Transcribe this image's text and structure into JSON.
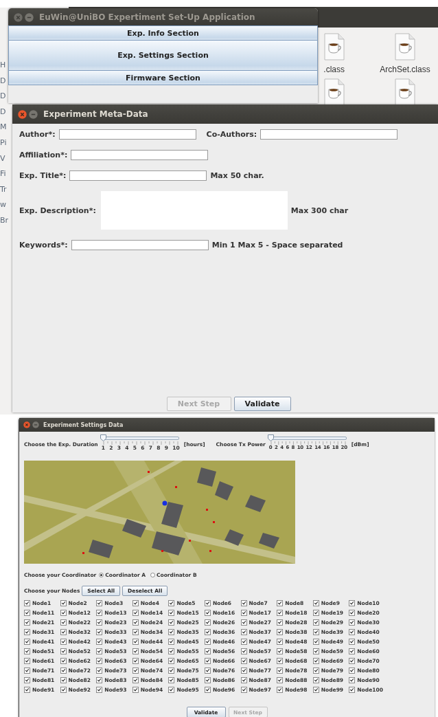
{
  "desktop": {
    "side_fragments": [
      "H",
      "D",
      "D",
      "D",
      "M",
      "Pi",
      "V",
      "Fi",
      "Tr",
      "w",
      "Br"
    ],
    "files": [
      {
        "name": ".class"
      },
      {
        "name": "ArchSet.class"
      }
    ]
  },
  "main_window": {
    "title": "EuWin@UniBO Expertiment Set-Up Application",
    "sections": [
      {
        "label": "Exp. Info Section",
        "kind": "short"
      },
      {
        "label": "Exp. Settings Section",
        "kind": "tall"
      },
      {
        "label": "Firmware Section",
        "kind": "short"
      }
    ]
  },
  "meta_window": {
    "title": "Experiment Meta-Data",
    "rows": [
      {
        "fields": [
          {
            "label": "Author*:",
            "kind": "line"
          },
          {
            "label": "Co-Authors:",
            "kind": "line"
          }
        ]
      },
      {
        "fields": [
          {
            "label": "Affiliation*:",
            "kind": "line"
          }
        ]
      },
      {
        "fields": [
          {
            "label": "Exp. Title*:",
            "kind": "line",
            "note": "Max 50 char."
          }
        ]
      },
      {
        "fields": [
          {
            "label": "Exp. Description*:",
            "kind": "area",
            "note": "Max 300 char"
          }
        ]
      },
      {
        "fields": [
          {
            "label": "Keywords*:",
            "kind": "line",
            "note": "Min 1 Max 5 - Space separated"
          }
        ]
      }
    ],
    "buttons": [
      {
        "label": "Next Step",
        "disabled": true
      },
      {
        "label": "Validate",
        "disabled": false
      }
    ]
  },
  "settings_window": {
    "title": "Experiment Settings Data",
    "sliders": [
      {
        "label": "Choose the Exp. Duration",
        "ticks": [
          "1",
          "2",
          "3",
          "4",
          "5",
          "6",
          "7",
          "8",
          "9",
          "10"
        ],
        "unit": "[hours]",
        "level": 0
      },
      {
        "label": "Choose Tx Power",
        "ticks": [
          "0",
          "2",
          "4",
          "6",
          "8",
          "10",
          "12",
          "14",
          "16",
          "18",
          "20"
        ],
        "unit": "[dBm]",
        "level": 0
      }
    ],
    "coordinator": {
      "label": "Choose your Coordinator",
      "options": [
        {
          "label": "Coordinator A",
          "selected": true
        },
        {
          "label": "Coordinator B",
          "selected": false
        }
      ]
    },
    "nodes": {
      "label": "Choose your Nodes",
      "buttons": [
        "Select All",
        "Deselect All"
      ],
      "items": [
        {
          "label": "Node1",
          "checked": true
        },
        {
          "label": "Node2",
          "checked": true
        },
        {
          "label": "Node3",
          "checked": true
        },
        {
          "label": "Node4",
          "checked": true
        },
        {
          "label": "Node5",
          "checked": true
        },
        {
          "label": "Node6",
          "checked": true
        },
        {
          "label": "Node7",
          "checked": true
        },
        {
          "label": "Node8",
          "checked": true
        },
        {
          "label": "Node9",
          "checked": true
        },
        {
          "label": "Node10",
          "checked": true
        },
        {
          "label": "Node11",
          "checked": true
        },
        {
          "label": "Node12",
          "checked": true
        },
        {
          "label": "Node13",
          "checked": true
        },
        {
          "label": "Node14",
          "checked": true
        },
        {
          "label": "Node15",
          "checked": true
        },
        {
          "label": "Node16",
          "checked": true
        },
        {
          "label": "Node17",
          "checked": true
        },
        {
          "label": "Node18",
          "checked": true
        },
        {
          "label": "Node19",
          "checked": true
        },
        {
          "label": "Node20",
          "checked": true
        },
        {
          "label": "Node21",
          "checked": true
        },
        {
          "label": "Node22",
          "checked": true
        },
        {
          "label": "Node23",
          "checked": true
        },
        {
          "label": "Node24",
          "checked": true
        },
        {
          "label": "Node25",
          "checked": true
        },
        {
          "label": "Node26",
          "checked": true
        },
        {
          "label": "Node27",
          "checked": true
        },
        {
          "label": "Node28",
          "checked": true
        },
        {
          "label": "Node29",
          "checked": true
        },
        {
          "label": "Node30",
          "checked": true
        },
        {
          "label": "Node31",
          "checked": true
        },
        {
          "label": "Node32",
          "checked": true
        },
        {
          "label": "Node33",
          "checked": true
        },
        {
          "label": "Node34",
          "checked": true
        },
        {
          "label": "Node35",
          "checked": true
        },
        {
          "label": "Node36",
          "checked": true
        },
        {
          "label": "Node37",
          "checked": true
        },
        {
          "label": "Node38",
          "checked": true
        },
        {
          "label": "Node39",
          "checked": true
        },
        {
          "label": "Node40",
          "checked": true
        },
        {
          "label": "Node41",
          "checked": true
        },
        {
          "label": "Node42",
          "checked": true
        },
        {
          "label": "Node43",
          "checked": true
        },
        {
          "label": "Node44",
          "checked": true
        },
        {
          "label": "Node45",
          "checked": true
        },
        {
          "label": "Node46",
          "checked": true
        },
        {
          "label": "Node47",
          "checked": true
        },
        {
          "label": "Node48",
          "checked": true
        },
        {
          "label": "Node49",
          "checked": true
        },
        {
          "label": "Node50",
          "checked": true
        },
        {
          "label": "Node51",
          "checked": true
        },
        {
          "label": "Node52",
          "checked": true
        },
        {
          "label": "Node53",
          "checked": true
        },
        {
          "label": "Node54",
          "checked": true
        },
        {
          "label": "Node55",
          "checked": true
        },
        {
          "label": "Node56",
          "checked": true
        },
        {
          "label": "Node57",
          "checked": true
        },
        {
          "label": "Node58",
          "checked": true
        },
        {
          "label": "Node59",
          "checked": true
        },
        {
          "label": "Node60",
          "checked": true
        },
        {
          "label": "Node61",
          "checked": true
        },
        {
          "label": "Node62",
          "checked": true
        },
        {
          "label": "Node63",
          "checked": true
        },
        {
          "label": "Node64",
          "checked": true
        },
        {
          "label": "Node65",
          "checked": true
        },
        {
          "label": "Node66",
          "checked": true
        },
        {
          "label": "Node67",
          "checked": true
        },
        {
          "label": "Node68",
          "checked": true
        },
        {
          "label": "Node69",
          "checked": true
        },
        {
          "label": "Node70",
          "checked": true
        },
        {
          "label": "Node71",
          "checked": true
        },
        {
          "label": "Node72",
          "checked": true
        },
        {
          "label": "Node73",
          "checked": true
        },
        {
          "label": "Node74",
          "checked": true
        },
        {
          "label": "Node75",
          "checked": true
        },
        {
          "label": "Node76",
          "checked": true
        },
        {
          "label": "Node77",
          "checked": true
        },
        {
          "label": "Node78",
          "checked": true
        },
        {
          "label": "Node79",
          "checked": true
        },
        {
          "label": "Node80",
          "checked": true
        },
        {
          "label": "Node81",
          "checked": true
        },
        {
          "label": "Node82",
          "checked": true
        },
        {
          "label": "Node83",
          "checked": true
        },
        {
          "label": "Node84",
          "checked": true
        },
        {
          "label": "Node85",
          "checked": true
        },
        {
          "label": "Node86",
          "checked": true
        },
        {
          "label": "Node87",
          "checked": true
        },
        {
          "label": "Node88",
          "checked": true
        },
        {
          "label": "Node89",
          "checked": true
        },
        {
          "label": "Node90",
          "checked": true
        },
        {
          "label": "Node91",
          "checked": true
        },
        {
          "label": "Node92",
          "checked": true
        },
        {
          "label": "Node93",
          "checked": true
        },
        {
          "label": "Node94",
          "checked": true
        },
        {
          "label": "Node95",
          "checked": true
        },
        {
          "label": "Node96",
          "checked": true
        },
        {
          "label": "Node97",
          "checked": true
        },
        {
          "label": "Node98",
          "checked": true
        },
        {
          "label": "Node99",
          "checked": true
        },
        {
          "label": "Node100",
          "checked": true
        }
      ]
    },
    "buttons": [
      {
        "label": "Validate",
        "disabled": false
      },
      {
        "label": "Next Step",
        "disabled": true
      }
    ]
  }
}
